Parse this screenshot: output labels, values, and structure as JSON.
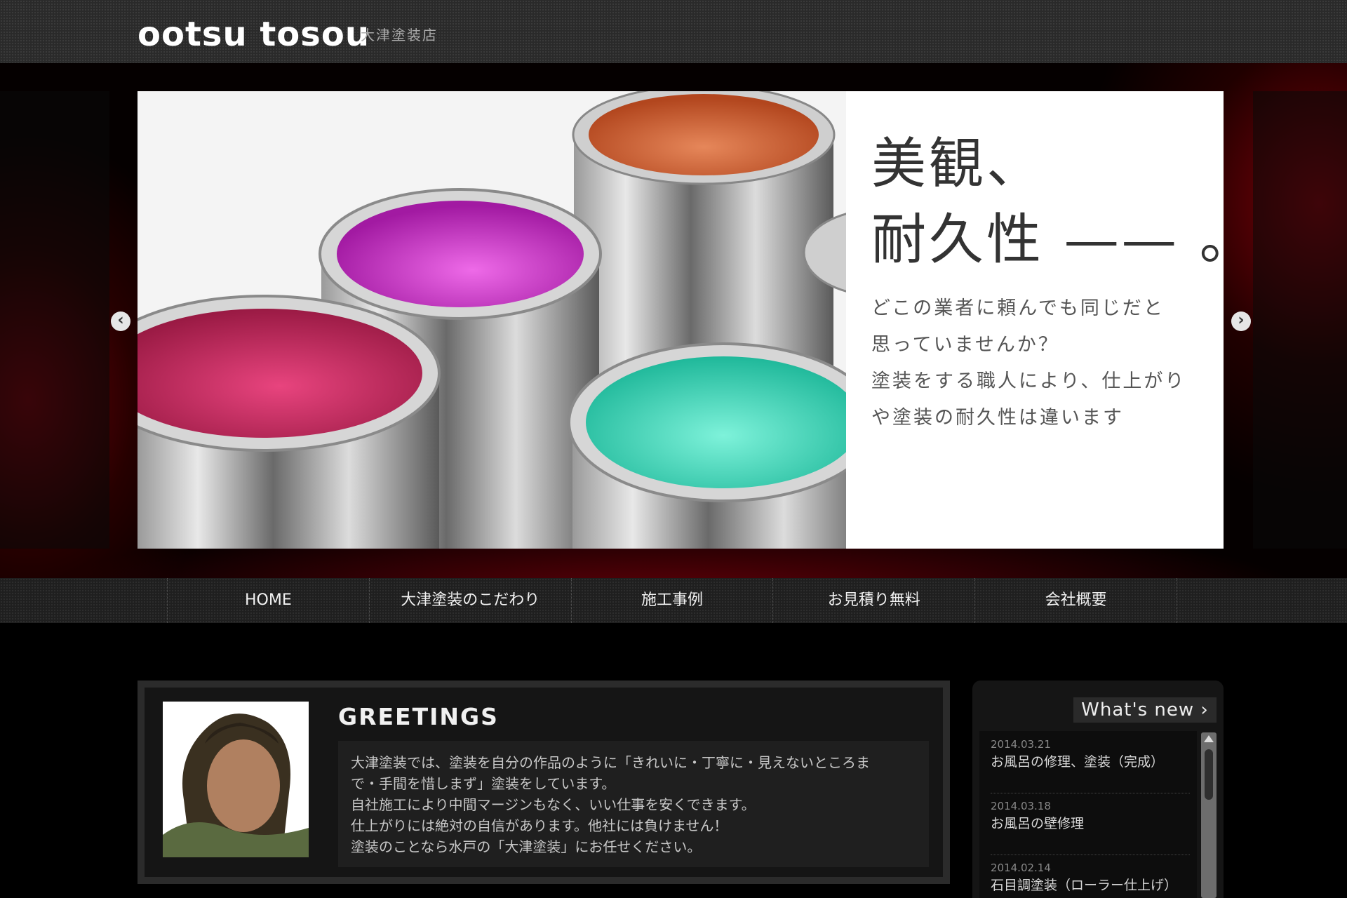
{
  "header": {
    "logo": "ootsu tosou",
    "logo_sub": "大津塗装店"
  },
  "hero": {
    "headline": [
      "美観、",
      "耐久性 —— 。"
    ],
    "text": [
      "どこの業者に頼んでも同じだと",
      "思っていませんか？",
      "塗装をする職人により、仕上がり",
      "や塗装の耐久性は違います"
    ],
    "prev_icon": "chevron-left-icon",
    "next_icon": "chevron-right-icon",
    "prev_glyph": "‹",
    "next_glyph": "›",
    "can_colors": [
      "#c4275a",
      "#c52ec4",
      "#c95a2a",
      "#2ec9a6"
    ]
  },
  "nav": {
    "items": [
      "HOME",
      "大津塗装のこだわり",
      "施工事例",
      "お見積り無料",
      "会社概要"
    ]
  },
  "greetings": {
    "title": "GREETINGS",
    "lines": [
      "大津塗装では、塗装を自分の作品のように「きれいに・丁寧に・見えないところま",
      "で・手間を惜しまず」塗装をしています。",
      "自社施工により中間マージンもなく、いい仕事を安くできます。",
      "仕上がりには絶対の自信があります。他社には負けません！",
      "塗装のことなら水戸の「大津塗装」にお任せください。"
    ]
  },
  "news": {
    "title": "What's new ›",
    "items": [
      {
        "date": "2014.03.21",
        "text": "お風呂の修理、塗装（完成）"
      },
      {
        "date": "2014.03.18",
        "text": "お風呂の壁修理"
      },
      {
        "date": "2014.02.14",
        "text": "石目調塗装（ローラー仕上げ）"
      }
    ]
  },
  "colors": {
    "accent_red": "#8a0010",
    "background": "#000000",
    "panel": "#151515"
  }
}
